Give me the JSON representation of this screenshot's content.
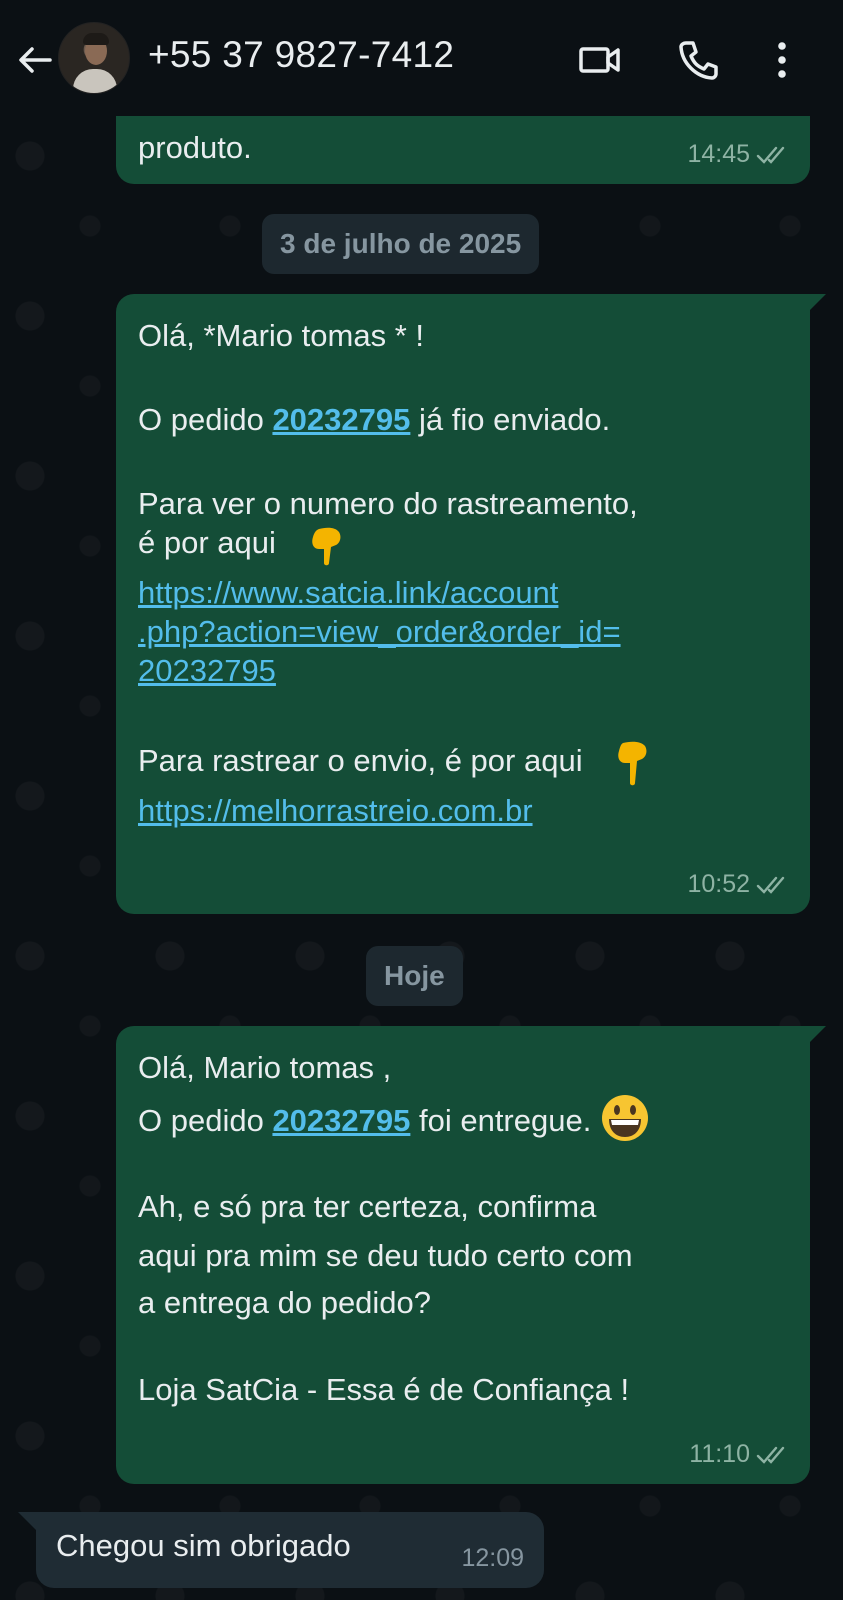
{
  "header": {
    "title": "+55 37 9827-7412"
  },
  "messages": {
    "prev": {
      "text": "produto.",
      "time": "14:45"
    },
    "date1": "3 de julho de 2025",
    "msg2": {
      "line1": "Olá, *Mario tomas * !",
      "order_prefix": "O pedido ",
      "order_number": "20232795",
      "order_suffix": " já fio enviado.",
      "track_line1": "Para ver o numero do rastreamento,",
      "track_line2": "é por aqui",
      "url1_line1": "https://www.satcia.link/account",
      "url1_line2": ".php?action=view_order&order_id=",
      "url1_line3": "20232795",
      "ship_line": "Para rastrear o envio, é por aqui",
      "url2": "https://melhorrastreio.com.br",
      "time": "10:52"
    },
    "date2": "Hoje",
    "msg3": {
      "line1": "Olá, Mario tomas ,",
      "order_prefix": "O pedido ",
      "order_number": "20232795",
      "order_suffix": " foi entregue.",
      "q_line1": "Ah, e só pra ter certeza, confirma",
      "q_line2": "aqui pra mim se deu tudo certo com",
      "q_line3": "a entrega do pedido?",
      "sign": "Loja SatCia - Essa é de Confiança !",
      "time": "11:10"
    },
    "reply": {
      "text": "Chegou sim obrigado",
      "time": "12:09"
    }
  },
  "icons": {
    "back": "arrow-left-icon",
    "video": "video-camera-icon",
    "call": "phone-icon",
    "menu": "more-vertical-icon",
    "read": "double-check-icon",
    "point_down": "backhand-index-pointing-down-emoji",
    "grin": "grinning-face-emoji"
  },
  "colors": {
    "background": "#0b1014",
    "outgoing_bubble": "#144d37",
    "incoming_bubble": "#1f2c34",
    "link": "#53bdeb"
  }
}
